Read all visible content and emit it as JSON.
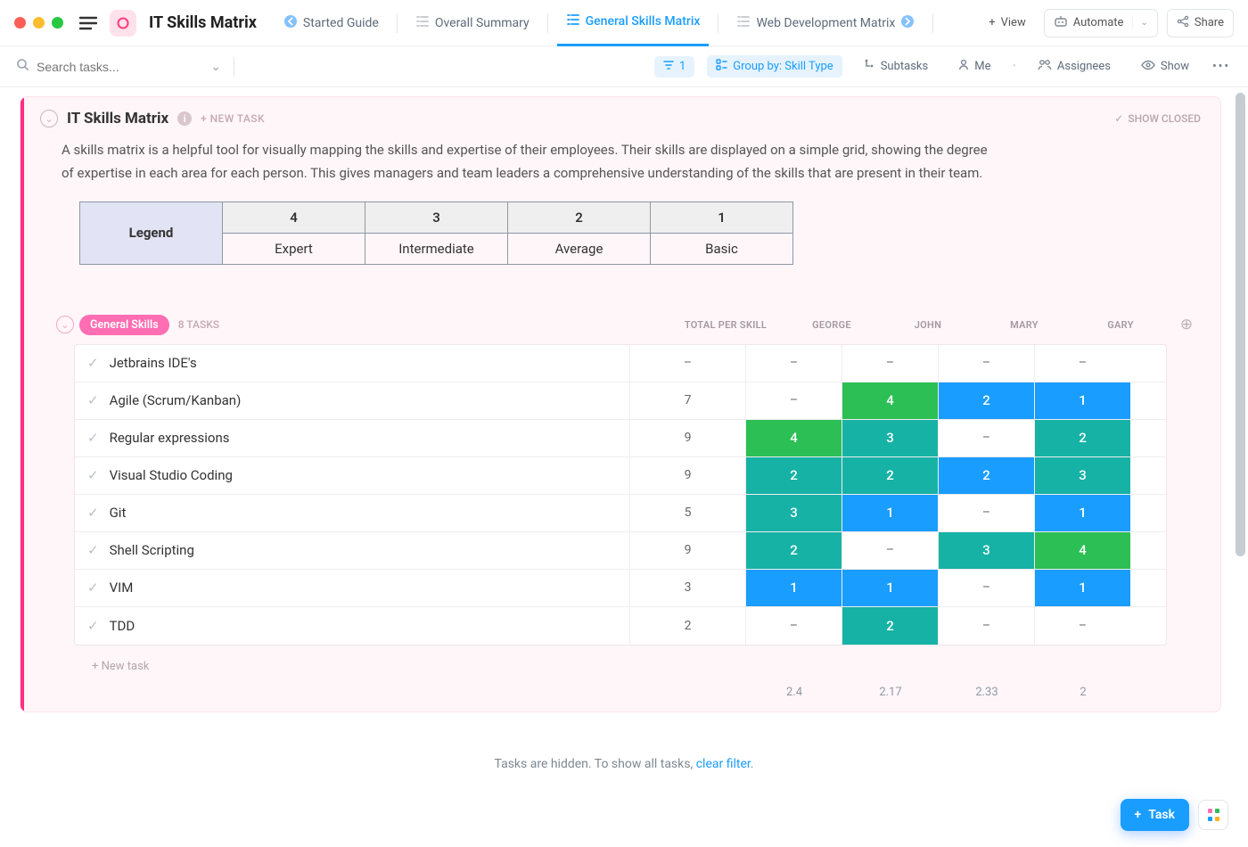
{
  "space": {
    "title": "IT Skills Matrix"
  },
  "tabs": {
    "items": [
      {
        "label": "Started Guide",
        "icon": "back"
      },
      {
        "label": "Overall Summary",
        "icon": "list"
      },
      {
        "label": "General Skills Matrix",
        "icon": "list",
        "active": true
      },
      {
        "label": "Web Development Matrix",
        "icon": "list",
        "trail": true
      }
    ],
    "add_view": "View"
  },
  "top_right": {
    "automate": "Automate",
    "share": "Share"
  },
  "toolbar": {
    "search_placeholder": "Search tasks...",
    "filter_count": "1",
    "group_by": "Group by: Skill Type",
    "subtasks": "Subtasks",
    "me": "Me",
    "assignees": "Assignees",
    "show": "Show"
  },
  "sheet": {
    "title": "IT Skills Matrix",
    "new_task": "+ NEW TASK",
    "show_closed": "SHOW CLOSED",
    "description": "A skills matrix is a helpful tool for visually mapping the skills and expertise of their employees. Their skills are displayed on a simple grid, showing the degree of expertise in each area for each person. This gives managers and team leaders a comprehensive understanding of the skills that are present in their team."
  },
  "legend": {
    "header": "Legend",
    "cols": [
      "4",
      "3",
      "2",
      "1"
    ],
    "labels": [
      "Expert",
      "Intermediate",
      "Average",
      "Basic"
    ]
  },
  "group": {
    "name": "General Skills",
    "task_count": "8 TASKS",
    "columns": [
      "TOTAL PER SKILL",
      "GEORGE",
      "JOHN",
      "MARY",
      "GARY"
    ],
    "rows": [
      {
        "name": "Jetbrains IDE's",
        "total": "–",
        "vals": [
          "–",
          "–",
          "–",
          "–"
        ]
      },
      {
        "name": "Agile (Scrum/Kanban)",
        "total": "7",
        "vals": [
          "–",
          "4",
          "2",
          "1"
        ]
      },
      {
        "name": "Regular expressions",
        "total": "9",
        "vals": [
          "4",
          "3",
          "–",
          "2"
        ]
      },
      {
        "name": "Visual Studio Coding",
        "total": "9",
        "vals": [
          "2",
          "2",
          "2",
          "3"
        ]
      },
      {
        "name": "Git",
        "total": "5",
        "vals": [
          "3",
          "1",
          "–",
          "1"
        ]
      },
      {
        "name": "Shell Scripting",
        "total": "9",
        "vals": [
          "2",
          "–",
          "3",
          "4"
        ]
      },
      {
        "name": "VIM",
        "total": "3",
        "vals": [
          "1",
          "1",
          "–",
          "1"
        ]
      },
      {
        "name": "TDD",
        "total": "2",
        "vals": [
          "–",
          "2",
          "–",
          "–"
        ]
      }
    ],
    "averages": [
      "2.4",
      "2.17",
      "2.33",
      "2"
    ],
    "new_task_row": "+ New task"
  },
  "footer": {
    "hidden_text": "Tasks are hidden. To show all tasks, ",
    "clear_filter": "clear filter",
    "fab": "Task"
  },
  "colors": {
    "4": "c-green",
    "3": "c-teal",
    "2": "c-teal",
    "1": "c-blue"
  },
  "color_overrides": {
    "1_3": "c-blue",
    "4_1": "c-blue",
    "5_3": "c-teal",
    "6_1": "c-blue",
    "2_0": "c-green",
    "4_0": "c-teal",
    "3_3": "c-teal",
    "7_1": "c-teal",
    "1_1": "c-green",
    "5_2": "c-teal",
    "5_3_alt": "c-green",
    "2_3": "c-teal",
    "3_0": "c-teal",
    "3_1": "c-teal",
    "3_2": "c-blue",
    "1_2": "c-blue",
    "4_3": "c-blue",
    "6_3": "c-blue",
    "6_0": "c-blue"
  },
  "cell_colors": [
    [
      "",
      "",
      "",
      ""
    ],
    [
      "",
      "c-green",
      "c-blue",
      "c-blue"
    ],
    [
      "c-green",
      "c-teal",
      "",
      "c-teal"
    ],
    [
      "c-teal",
      "c-teal",
      "c-blue",
      "c-teal"
    ],
    [
      "c-teal",
      "c-blue",
      "",
      "c-blue"
    ],
    [
      "c-teal",
      "",
      "c-teal",
      "c-green"
    ],
    [
      "c-blue",
      "c-blue",
      "",
      "c-blue"
    ],
    [
      "",
      "c-teal",
      "",
      ""
    ]
  ]
}
